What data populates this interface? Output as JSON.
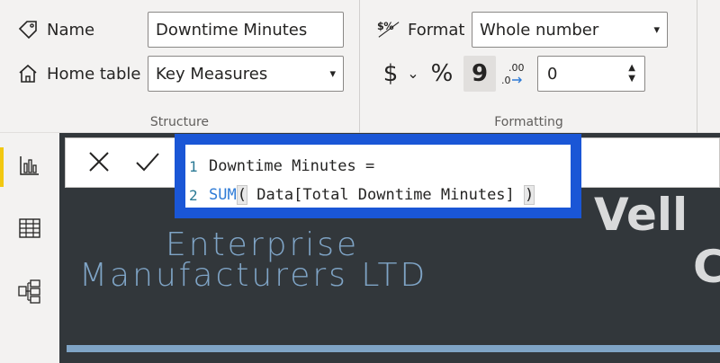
{
  "structure": {
    "group_label": "Structure",
    "name_label": "Name",
    "name_value": "Downtime Minutes",
    "home_table_label": "Home table",
    "home_table_value": "Key Measures"
  },
  "formatting": {
    "group_label": "Formatting",
    "format_label": "Format",
    "format_value": "Whole number",
    "currency_symbol": "$",
    "currency_chevron": "⌄",
    "percent_symbol": "%",
    "comma_symbol": "9",
    "decimal_places": "0"
  },
  "editor": {
    "lines": [
      {
        "number": "1",
        "text": "Downtime Minutes ="
      },
      {
        "number": "2",
        "keyword": "SUM",
        "open": "(",
        "arg": " Data[Total Downtime Minutes] ",
        "close": ")"
      }
    ]
  },
  "canvas": {
    "logo_line1": "Enterprise",
    "logo_line2": "Manufacturers LTD",
    "partial_title_1": "Vell",
    "partial_title_2": "C"
  },
  "colors": {
    "accent_yellow": "#f2c811",
    "editor_border": "#1a56d6",
    "canvas_bg": "#32373b",
    "logo_text": "#7fa4c6"
  }
}
